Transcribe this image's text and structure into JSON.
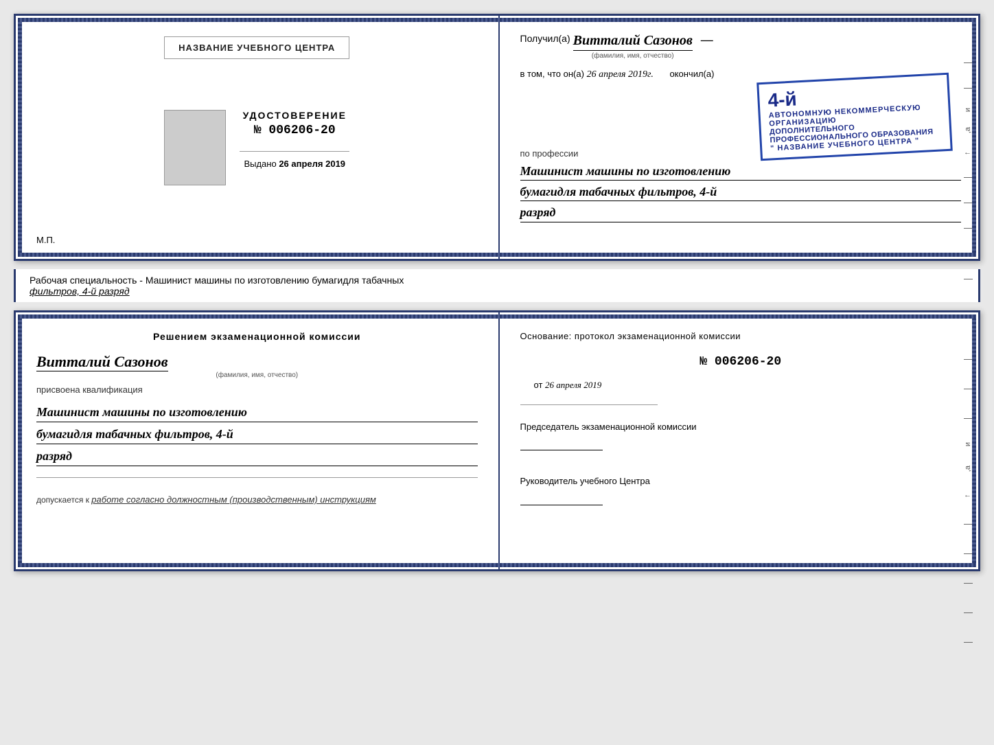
{
  "topBooklet": {
    "left": {
      "certTitleLabel": "НАЗВАНИЕ УЧЕБНОГО ЦЕНТРА",
      "docLabel": "УДОСТОВЕРЕНИЕ",
      "docNumber": "№ 006206-20",
      "issuedLabel": "Выдано",
      "issuedDate": "26 апреля 2019",
      "mpLabel": "М.П."
    },
    "right": {
      "recipientPrefix": "Получил(а)",
      "recipientName": "Витталий  Сазонов",
      "recipientCaption": "(фамилия, имя, отчество)",
      "dateLine": "в том, что он(а)",
      "dateValue": "26 апреля 2019г.",
      "finishedLabel": "окончил(а)",
      "stampLine1": "АВТОНОМНУЮ НЕКОММЕРЧЕСКУЮ ОРГАНИЗАЦИЮ",
      "stampLine2": "ДОПОЛНИТЕЛЬНОГО ПРОФЕССИОНАЛЬНОГО ОБРАЗОВАНИЯ",
      "stampLine3": "\" НАЗВАНИЕ УЧЕБНОГО ЦЕНТРА \"",
      "stampHighlight": "4-й",
      "professionLabel": "по профессии",
      "professionText1": "Машинист машины по изготовлению",
      "professionText2": "бумагидля табачных фильтров, 4-й",
      "professionText3": "разряд"
    }
  },
  "middleStrip": {
    "text": "Рабочая специальность - Машинист машины по изготовлению бумагидля табачных",
    "text2": "фильтров, 4-й разряд"
  },
  "bottomBooklet": {
    "left": {
      "commissionHeading": "Решением  экзаменационной  комиссии",
      "personName": "Витталий Сазонов",
      "personCaption": "(фамилия, имя, отчество)",
      "qualificationLabel": "присвоена квалификация",
      "qualText1": "Машинист машины по изготовлению",
      "qualText2": "бумагидля табачных фильтров, 4-й",
      "qualText3": "разряд",
      "admissionPrefix": "допускается к",
      "admissionText": "работе согласно должностным (производственным) инструкциям"
    },
    "right": {
      "basisLabel": "Основание: протокол экзаменационной  комиссии",
      "protocolNumber": "№  006206-20",
      "fromLabel": "от",
      "fromDate": "26 апреля 2019",
      "chairmanLabel": "Председатель экзаменационной комиссии",
      "directorLabel": "Руководитель учебного Центра"
    }
  }
}
